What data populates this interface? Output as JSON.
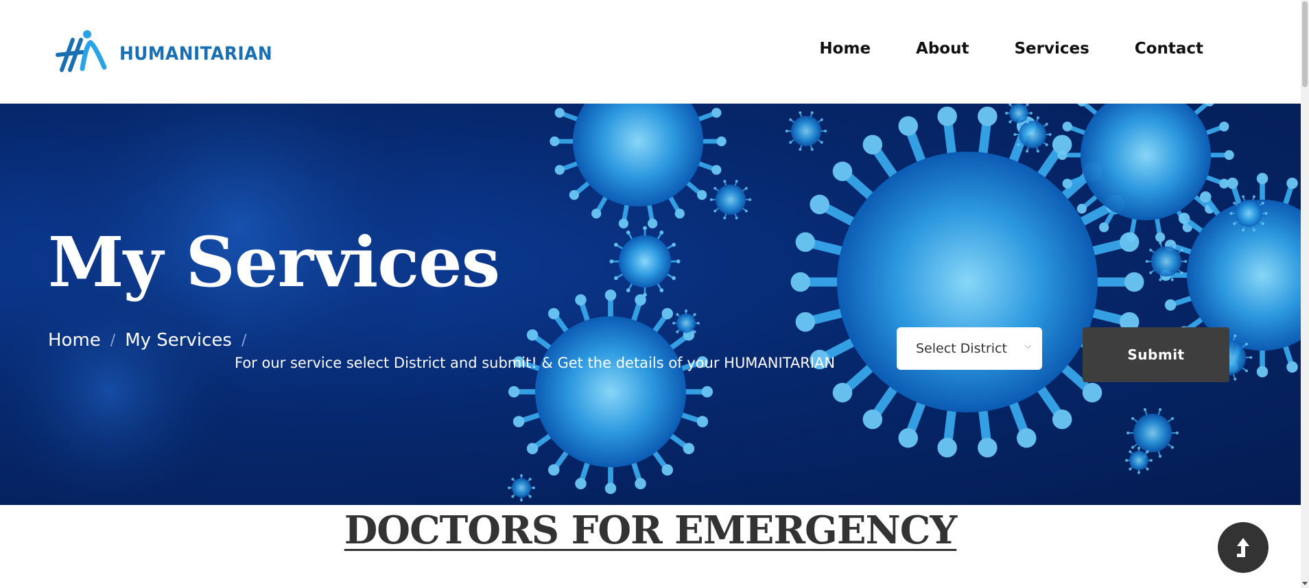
{
  "header": {
    "logo_text": "HUMANITARIAN",
    "brand_color": "#1a6fb3",
    "nav": [
      {
        "label": "Home"
      },
      {
        "label": "About"
      },
      {
        "label": "Services"
      },
      {
        "label": "Contact"
      }
    ]
  },
  "hero": {
    "title": "My Services",
    "breadcrumb": [
      {
        "label": "Home"
      },
      {
        "label": "My Services"
      }
    ],
    "breadcrumb_separator": "/",
    "description": "For our service select District and submit! & Get the details of your HUMANITARIAN",
    "district_select": {
      "selected": "Select District"
    },
    "submit_label": "Submit"
  },
  "section": {
    "title": "DOCTORS FOR EMERGENCY"
  },
  "colors": {
    "hero_bg": "#06286e",
    "virus": "#3aa8e8",
    "button_dark": "#3e3e3e"
  }
}
